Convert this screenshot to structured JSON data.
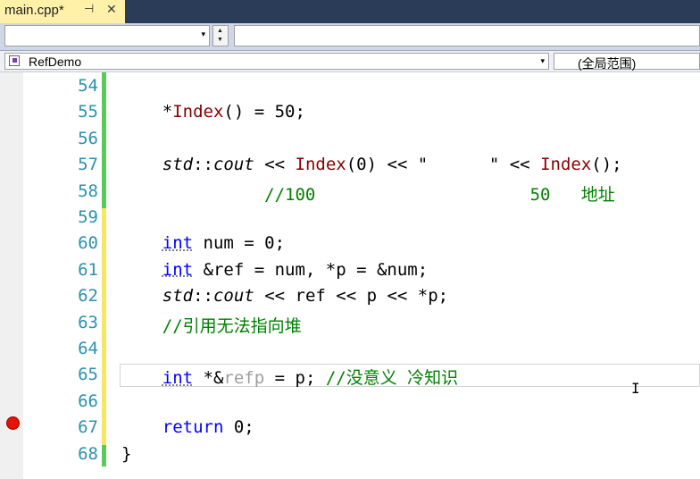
{
  "tab": {
    "title": "main.cpp*",
    "pin_glyph": "⊣",
    "close_glyph": "✕"
  },
  "toolbar": {
    "combo_value": "",
    "combo2_value": "",
    "arrow_glyph": "▾",
    "spin_up": "▲",
    "spin_down": "▼"
  },
  "nav": {
    "scope_label": "RefDemo",
    "member_label": "(全局范围)"
  },
  "caret_glyph": "I",
  "editor": {
    "lines": [
      {
        "num": "54",
        "code": []
      },
      {
        "num": "55",
        "code": [
          [
            "p",
            "    *"
          ],
          [
            "fn",
            "Index"
          ],
          [
            "p",
            "() = 50;"
          ]
        ]
      },
      {
        "num": "56",
        "code": []
      },
      {
        "num": "57",
        "code": [
          [
            "p",
            "    "
          ],
          [
            "it",
            "std"
          ],
          [
            "p",
            "::"
          ],
          [
            "it",
            "cout"
          ],
          [
            "p",
            " << "
          ],
          [
            "fn",
            "Index"
          ],
          [
            "p",
            "(0) << \"      \" << "
          ],
          [
            "fn",
            "Index"
          ],
          [
            "p",
            "();"
          ]
        ]
      },
      {
        "num": "58",
        "code": [
          [
            "p",
            "              "
          ],
          [
            "cm",
            "//100                     50   地址"
          ]
        ]
      },
      {
        "num": "59",
        "code": []
      },
      {
        "num": "60",
        "code": [
          [
            "p",
            "    "
          ],
          [
            "kwd",
            "int"
          ],
          [
            "p",
            " num = 0;"
          ]
        ]
      },
      {
        "num": "61",
        "code": [
          [
            "p",
            "    "
          ],
          [
            "kwd",
            "int"
          ],
          [
            "p",
            " &ref = num, *p = &num;"
          ]
        ]
      },
      {
        "num": "62",
        "code": [
          [
            "p",
            "    "
          ],
          [
            "it",
            "std"
          ],
          [
            "p",
            "::"
          ],
          [
            "it",
            "cout"
          ],
          [
            "p",
            " << ref << p << *p;"
          ]
        ]
      },
      {
        "num": "63",
        "code": [
          [
            "p",
            "    "
          ],
          [
            "cm",
            "//引用无法指向堆"
          ]
        ]
      },
      {
        "num": "64",
        "code": []
      },
      {
        "num": "65",
        "code": [
          [
            "p",
            "    "
          ],
          [
            "kwd",
            "int"
          ],
          [
            "p",
            " *&"
          ],
          [
            "gr",
            "refp"
          ],
          [
            "p",
            " = p; "
          ],
          [
            "cm",
            "//没意义 冷知识"
          ]
        ]
      },
      {
        "num": "66",
        "code": []
      },
      {
        "num": "67",
        "code": [
          [
            "p",
            "    "
          ],
          [
            "kw",
            "return"
          ],
          [
            "p",
            " 0;"
          ]
        ]
      },
      {
        "num": "68",
        "code": [
          [
            "p",
            "}"
          ]
        ]
      }
    ]
  },
  "colors": {
    "changed_saved": "#5ac85a",
    "changed_unsaved": "#f5e663",
    "breakpoint": "#e51400"
  }
}
